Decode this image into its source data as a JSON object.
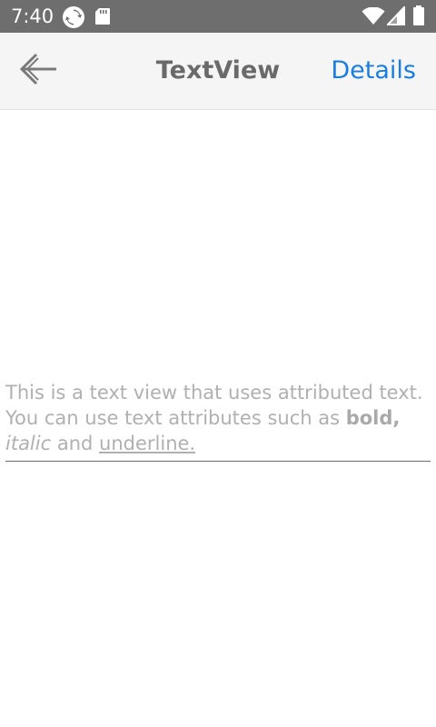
{
  "status_bar": {
    "time": "7:40",
    "left_icons": [
      "sync-icon",
      "sd-card-icon"
    ],
    "right_icons": [
      "wifi-icon",
      "cell-signal-icon",
      "battery-icon"
    ],
    "background_color": "#6e6e6e"
  },
  "nav_bar": {
    "back_icon": "arrow-left-icon",
    "title": "TextView",
    "details_label": "Details",
    "accent_color": "#1a7de0"
  },
  "content": {
    "segments": {
      "intro": "This is a text view that uses attributed text. You can use text attributes such as ",
      "bold": "bold,",
      "space1": " ",
      "italic": "italic",
      "and_text": " and ",
      "underline": "underline."
    }
  }
}
